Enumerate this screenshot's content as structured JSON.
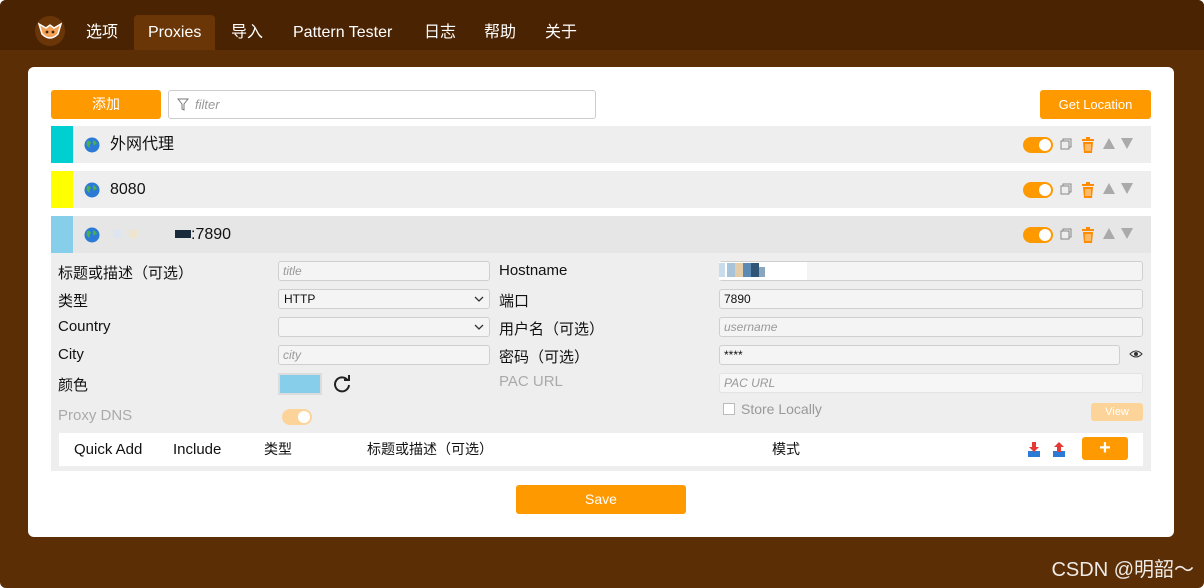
{
  "nav": {
    "tabs": [
      "选项",
      "Proxies",
      "导入",
      "Pattern Tester",
      "日志",
      "帮助",
      "关于"
    ],
    "active": "Proxies"
  },
  "toolbar": {
    "add_label": "添加",
    "filter_placeholder": "filter",
    "get_location_label": "Get Location"
  },
  "proxies": [
    {
      "title": "外网代理",
      "color": "#00cfd1",
      "enabled": true
    },
    {
      "title": "8080",
      "color": "#ffff00",
      "enabled": true
    },
    {
      "title": ":7890",
      "color": "#87ceeb",
      "enabled": true
    }
  ],
  "form": {
    "title_label": "标题或描述（可选）",
    "title_placeholder": "title",
    "type_label": "类型",
    "type_value": "HTTP",
    "country_label": "Country",
    "country_value": "",
    "city_label": "City",
    "city_placeholder": "city",
    "color_label": "颜色",
    "color_value": "#87ceeb",
    "proxy_dns_label": "Proxy DNS",
    "hostname_label": "Hostname",
    "hostname_value": "",
    "port_label": "端口",
    "port_value": "7890",
    "username_label": "用户名（可选）",
    "username_placeholder": "username",
    "password_label": "密码（可选）",
    "password_value": "****",
    "pac_label": "PAC URL",
    "pac_placeholder": "PAC URL",
    "store_locally_label": "Store Locally",
    "view_label": "View"
  },
  "patterns": {
    "quick_add": "Quick Add",
    "include": "Include",
    "type": "类型",
    "title": "标题或描述（可选）",
    "mode": "模式",
    "add_label": "+"
  },
  "save_label": "Save",
  "watermark": "CSDN @明韶～"
}
